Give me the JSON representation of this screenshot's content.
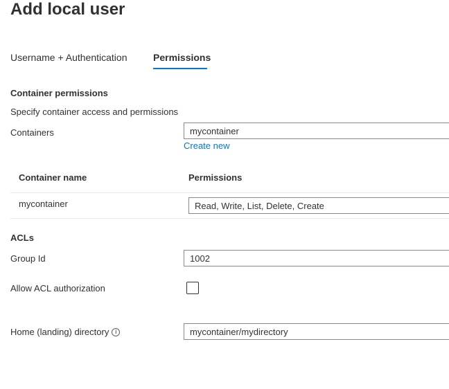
{
  "page": {
    "title": "Add local user"
  },
  "tabs": [
    {
      "label": "Username + Authentication",
      "selected": false
    },
    {
      "label": "Permissions",
      "selected": true
    }
  ],
  "container_permissions": {
    "heading": "Container permissions",
    "description": "Specify container access and permissions",
    "containers_label": "Containers",
    "containers_value": "mycontainer",
    "create_new_link": "Create new"
  },
  "permissions_table": {
    "columns": [
      "Container name",
      "Permissions"
    ],
    "rows": [
      {
        "container": "mycontainer",
        "permissions": "Read, Write, List, Delete, Create"
      }
    ]
  },
  "acls": {
    "heading": "ACLs",
    "group_id_label": "Group Id",
    "group_id_value": "1002",
    "allow_acl_label": "Allow ACL authorization",
    "allow_acl_checked": false
  },
  "home_directory": {
    "label": "Home (landing) directory",
    "info_icon": "info-icon",
    "value": "mycontainer/mydirectory"
  },
  "colors": {
    "accent": "#0078d4",
    "text": "#323130",
    "border": "#8a8886",
    "divider": "#edebe9"
  }
}
